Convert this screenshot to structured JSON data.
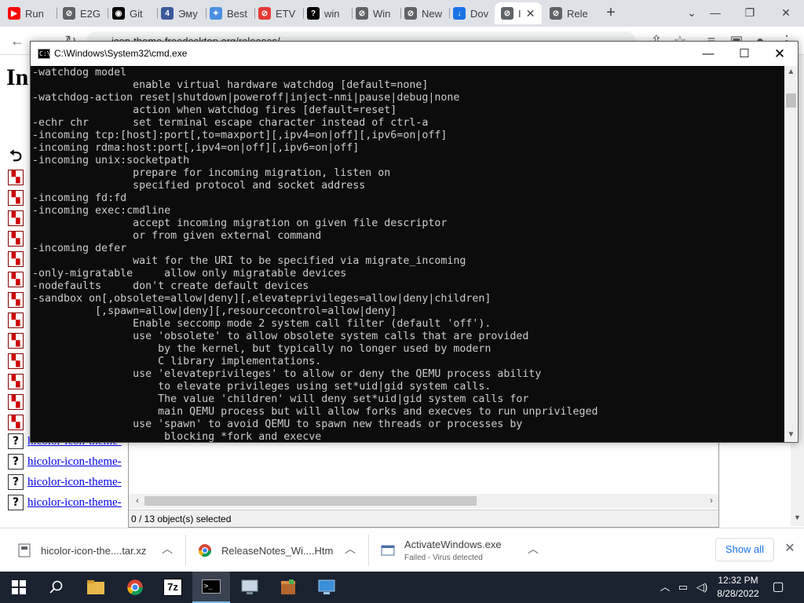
{
  "browser": {
    "tabs": [
      {
        "label": "Run",
        "fav_color": "#ff0000",
        "fav_glyph": "▶"
      },
      {
        "label": "E2G",
        "fav_color": "#5f6368",
        "fav_glyph": "⊘"
      },
      {
        "label": "Git",
        "fav_color": "#000000",
        "fav_glyph": "◉"
      },
      {
        "label": "Эму",
        "fav_color": "#3b5998",
        "fav_glyph": "4"
      },
      {
        "label": "Best",
        "fav_color": "#4a90e2",
        "fav_glyph": "✦"
      },
      {
        "label": "ETV",
        "fav_color": "#e53935",
        "fav_glyph": "⊘"
      },
      {
        "label": "win",
        "fav_color": "#000000",
        "fav_glyph": "?"
      },
      {
        "label": "Win",
        "fav_color": "#5f6368",
        "fav_glyph": "⊘"
      },
      {
        "label": "New",
        "fav_color": "#5f6368",
        "fav_glyph": "⊘"
      },
      {
        "label": "Dov",
        "fav_color": "#1a73e8",
        "fav_glyph": "↓"
      },
      {
        "label": "I",
        "fav_color": "#5f6368",
        "fav_glyph": "⊘"
      },
      {
        "label": "Rele",
        "fav_color": "#5f6368",
        "fav_glyph": "⊘"
      }
    ],
    "address": "icon-theme.freedesktop.org/releases/"
  },
  "page": {
    "heading": "In",
    "file_links": [
      "hicolor-icon-theme-",
      "hicolor-icon-theme-",
      "hicolor-icon-theme-",
      "hicolor-icon-theme-"
    ]
  },
  "zip": {
    "status": "0 / 13 object(s) selected"
  },
  "cmd": {
    "title": "C:\\Windows\\System32\\cmd.exe",
    "lines": [
      "-watchdog model",
      "                enable virtual hardware watchdog [default=none]",
      "-watchdog-action reset|shutdown|poweroff|inject-nmi|pause|debug|none",
      "                action when watchdog fires [default=reset]",
      "-echr chr       set terminal escape character instead of ctrl-a",
      "-incoming tcp:[host]:port[,to=maxport][,ipv4=on|off][,ipv6=on|off]",
      "-incoming rdma:host:port[,ipv4=on|off][,ipv6=on|off]",
      "-incoming unix:socketpath",
      "                prepare for incoming migration, listen on",
      "                specified protocol and socket address",
      "-incoming fd:fd",
      "-incoming exec:cmdline",
      "                accept incoming migration on given file descriptor",
      "                or from given external command",
      "-incoming defer",
      "                wait for the URI to be specified via migrate_incoming",
      "-only-migratable     allow only migratable devices",
      "-nodefaults     don't create default devices",
      "-sandbox on[,obsolete=allow|deny][,elevateprivileges=allow|deny|children]",
      "          [,spawn=allow|deny][,resourcecontrol=allow|deny]",
      "                Enable seccomp mode 2 system call filter (default 'off').",
      "                use 'obsolete' to allow obsolete system calls that are provided",
      "                    by the kernel, but typically no longer used by modern",
      "                    C library implementations.",
      "                use 'elevateprivileges' to allow or deny the QEMU process ability",
      "                    to elevate privileges using set*uid|gid system calls.",
      "                    The value 'children' will deny set*uid|gid system calls for",
      "                    main QEMU process but will allow forks and execves to run unprivileged",
      "                use 'spawn' to avoid QEMU to spawn new threads or processes by",
      "                     blocking *fork and execve"
    ]
  },
  "downloads": {
    "items": [
      {
        "name": "hicolor-icon-the....tar.xz",
        "sub": ""
      },
      {
        "name": "ReleaseNotes_Wi....Htm",
        "sub": ""
      },
      {
        "name": "ActivateWindows.exe",
        "sub": "Failed - Virus detected"
      }
    ],
    "show_all": "Show all"
  },
  "taskbar": {
    "time": "12:32 PM",
    "date": "8/28/2022",
    "zip_label": "7z"
  }
}
